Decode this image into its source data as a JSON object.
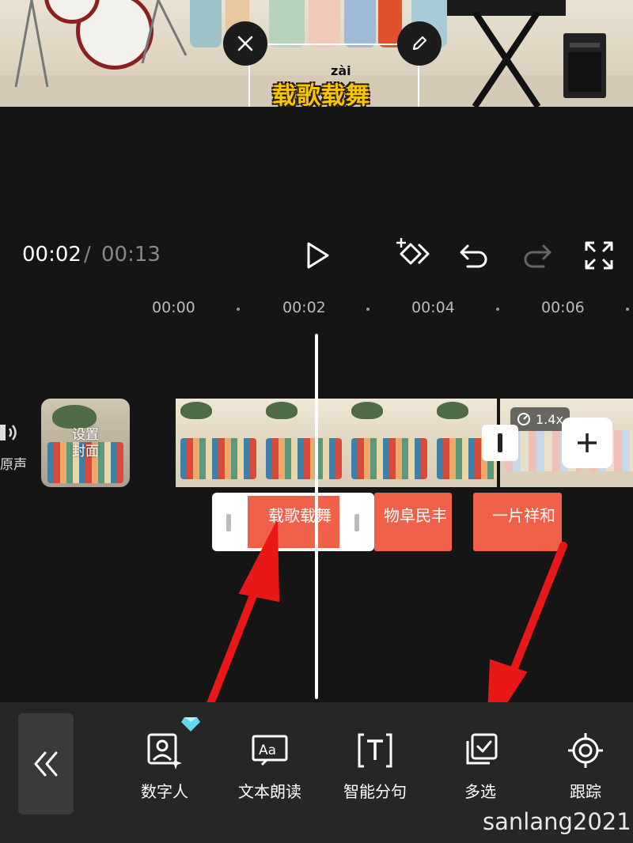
{
  "preview": {
    "caption": "载歌载舞",
    "pinyin": "zài"
  },
  "player": {
    "current_time": "00:02",
    "separator": "/",
    "total_time": "00:13"
  },
  "ruler": {
    "ticks": [
      "00:00",
      "00:02",
      "00:04",
      "00:06"
    ]
  },
  "tracks": {
    "original_audio_label": "原声",
    "cover_label_line1": "设置",
    "cover_label_line2": "封面",
    "speed_badge": "1.4x"
  },
  "text_clips": [
    "载歌载舞",
    "物阜民丰",
    "一片祥和"
  ],
  "toolbar": {
    "items": [
      {
        "label": "数字人",
        "icon": "digital-human-icon"
      },
      {
        "label": "文本朗读",
        "icon": "text-to-speech-icon"
      },
      {
        "label": "智能分句",
        "icon": "smart-split-icon"
      },
      {
        "label": "多选",
        "icon": "multi-select-icon"
      },
      {
        "label": "跟踪",
        "icon": "tracking-icon"
      }
    ]
  },
  "watermark": "sanlang2021",
  "colors": {
    "accent": "#f0614a",
    "caption": "#f7c600",
    "background": "#151515",
    "toolbar": "#262626",
    "arrow": "#e81818"
  }
}
